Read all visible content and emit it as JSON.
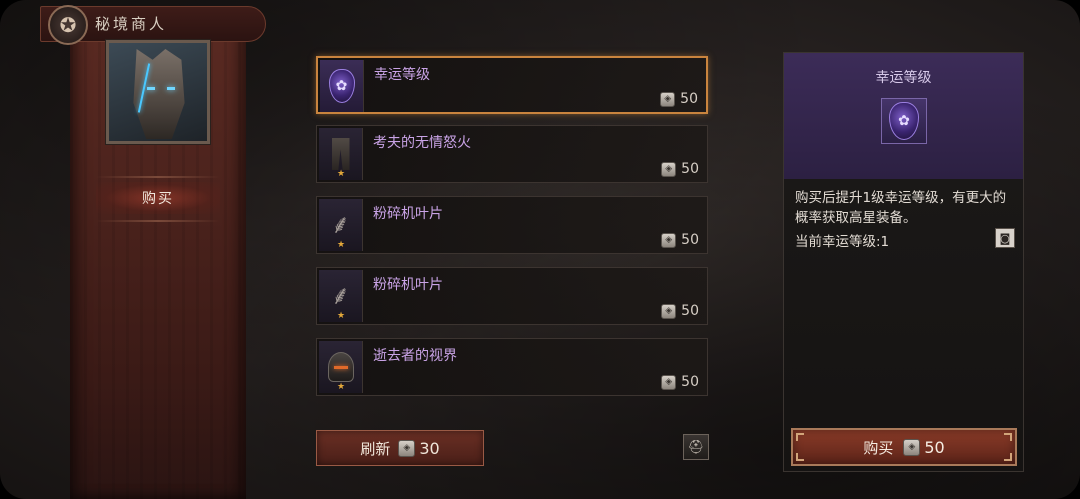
{
  "header": {
    "title": "秘境商人",
    "emblem_icon": "pentagram-icon"
  },
  "sidebar": {
    "tabs": [
      {
        "label": "购买",
        "active": true
      }
    ]
  },
  "items": [
    {
      "name": "幸运等级",
      "price": "50",
      "icon": "luck-gem-icon",
      "selected": true
    },
    {
      "name": "考夫的无情怒火",
      "price": "50",
      "icon": "pants-icon",
      "star": "★"
    },
    {
      "name": "粉碎机叶片",
      "price": "50",
      "icon": "scythe-icon",
      "star": "★"
    },
    {
      "name": "粉碎机叶片",
      "price": "50",
      "icon": "scythe-icon",
      "star": "★"
    },
    {
      "name": "逝去者的视界",
      "price": "50",
      "icon": "helmet-icon",
      "star": "★"
    }
  ],
  "refresh": {
    "label": "刷新",
    "price": "30"
  },
  "detail": {
    "title": "幸运等级",
    "description": "购买后提升1级幸运等级，有更大的概率获取高星装备。",
    "current_level": "当前幸运等级:1",
    "buy_label": "购买",
    "buy_price": "50"
  },
  "colors": {
    "accent_selected": "#c9843e",
    "item_name": "#c9a3e6",
    "button_red": "#6a2f24"
  }
}
